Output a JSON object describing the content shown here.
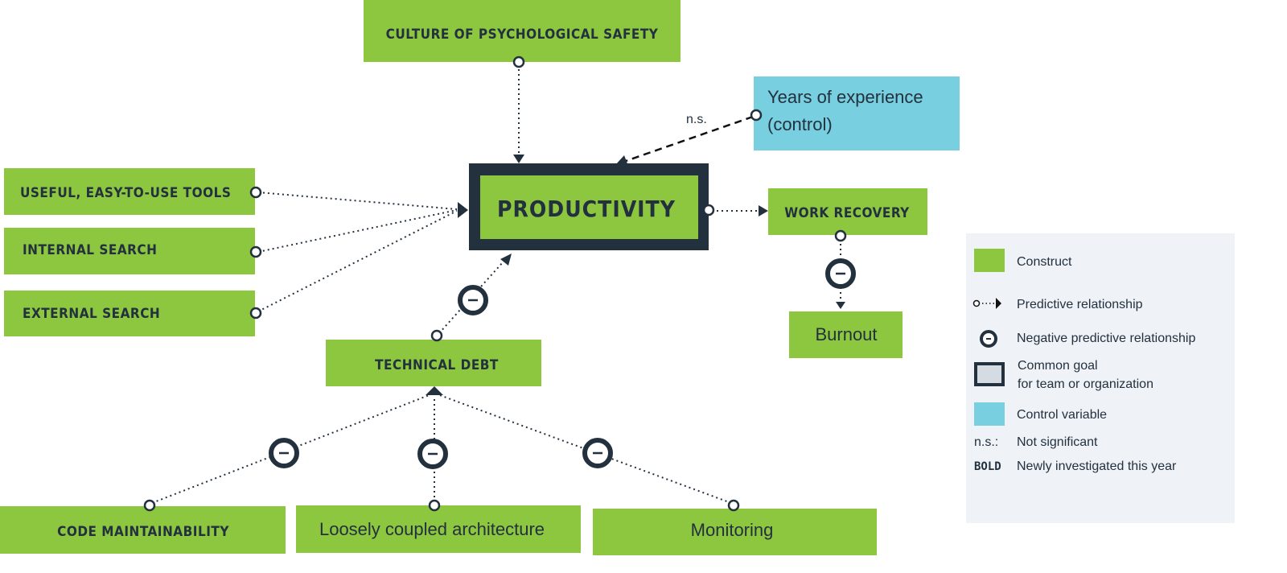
{
  "nodes": {
    "culture": "CULTURE OF PSYCHOLOGICAL SAFETY",
    "years_line1": "Years of experience",
    "years_line2": "(control)",
    "productivity": "PRODUCTIVITY",
    "useful_tools": "USEFUL, EASY-TO-USE TOOLS",
    "internal_search": "INTERNAL SEARCH",
    "external_search": "EXTERNAL SEARCH",
    "work_recovery": "WORK RECOVERY",
    "burnout": "Burnout",
    "technical_debt": "TECHNICAL DEBT",
    "code_maintainability": "CODE MAINTAINABILITY",
    "loosely_coupled": "Loosely coupled architecture",
    "monitoring": "Monitoring"
  },
  "labels": {
    "ns": "n.s."
  },
  "legend": {
    "construct": "Construct",
    "predictive": "Predictive relationship",
    "negative": "Negative predictive relationship",
    "goal_line1": "Common goal",
    "goal_line2": "for team or organization",
    "control": "Control variable",
    "ns_key": "n.s.:",
    "ns_desc": "Not significant",
    "bold_key": "BOLD",
    "bold_desc": "Newly investigated this year"
  },
  "colors": {
    "construct": "#8dc63f",
    "control": "#78cfe0",
    "goal_border": "#23313f",
    "legend_bg": "#eff2f6"
  }
}
